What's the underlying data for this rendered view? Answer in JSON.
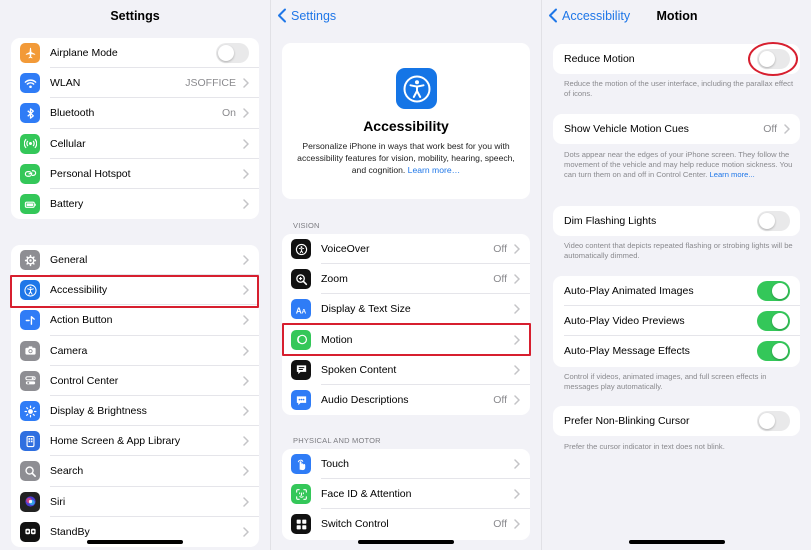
{
  "settings": {
    "title": "Settings",
    "group1": [
      {
        "label": "Airplane Mode",
        "icon": "airplane-icon",
        "color": "#f29a38",
        "toggle": false
      },
      {
        "label": "WLAN",
        "icon": "wifi-icon",
        "color": "#2f7cf6",
        "value": "JSOFFICE"
      },
      {
        "label": "Bluetooth",
        "icon": "bluetooth-icon",
        "color": "#2f7cf6",
        "value": "On"
      },
      {
        "label": "Cellular",
        "icon": "cellular-icon",
        "color": "#34c759"
      },
      {
        "label": "Personal Hotspot",
        "icon": "hotspot-icon",
        "color": "#34c759"
      },
      {
        "label": "Battery",
        "icon": "battery-icon",
        "color": "#34c759"
      }
    ],
    "group2": [
      {
        "label": "General",
        "icon": "gear-icon",
        "color": "#8e8e93"
      },
      {
        "label": "Accessibility",
        "icon": "accessibility-icon",
        "color": "#1f77e8"
      },
      {
        "label": "Action Button",
        "icon": "action-button-icon",
        "color": "#2f7cf6"
      },
      {
        "label": "Camera",
        "icon": "camera-icon",
        "color": "#8e8e93"
      },
      {
        "label": "Control Center",
        "icon": "control-center-icon",
        "color": "#8e8e93"
      },
      {
        "label": "Display & Brightness",
        "icon": "brightness-icon",
        "color": "#2f7cf6"
      },
      {
        "label": "Home Screen & App Library",
        "icon": "home-screen-icon",
        "color": "#2f6fe0"
      },
      {
        "label": "Search",
        "icon": "search-icon",
        "color": "#8e8e93"
      },
      {
        "label": "Siri",
        "icon": "siri-icon",
        "color": "#222222"
      },
      {
        "label": "StandBy",
        "icon": "standby-icon",
        "color": "#111111"
      }
    ]
  },
  "accessibility": {
    "back": "Settings",
    "hero_title": "Accessibility",
    "hero_desc": "Personalize iPhone in ways that work best for you with accessibility features for vision, mobility, hearing, speech, and cognition.",
    "hero_link": "Learn more…",
    "vision_header": "VISION",
    "vision": [
      {
        "label": "VoiceOver",
        "icon": "voiceover-icon",
        "color": "#111111",
        "value": "Off"
      },
      {
        "label": "Zoom",
        "icon": "zoom-icon",
        "color": "#111111",
        "value": "Off"
      },
      {
        "label": "Display & Text Size",
        "icon": "text-size-icon",
        "color": "#2f7cf6"
      },
      {
        "label": "Motion",
        "icon": "motion-icon",
        "color": "#34c759"
      },
      {
        "label": "Spoken Content",
        "icon": "spoken-content-icon",
        "color": "#111111"
      },
      {
        "label": "Audio Descriptions",
        "icon": "audio-descriptions-icon",
        "color": "#2f7cf6",
        "value": "Off"
      }
    ],
    "physical_header": "PHYSICAL AND MOTOR",
    "physical": [
      {
        "label": "Touch",
        "icon": "touch-icon",
        "color": "#2f7cf6"
      },
      {
        "label": "Face ID & Attention",
        "icon": "face-id-icon",
        "color": "#34c759"
      },
      {
        "label": "Switch Control",
        "icon": "switch-control-icon",
        "color": "#111111",
        "value": "Off"
      }
    ]
  },
  "motion": {
    "back": "Accessibility",
    "title": "Motion",
    "reduce_motion": {
      "label": "Reduce Motion",
      "on": false
    },
    "reduce_note": "Reduce the motion of the user interface, including the parallax effect of icons.",
    "vehicle": {
      "label": "Show Vehicle Motion Cues",
      "value": "Off"
    },
    "vehicle_note": "Dots appear near the edges of your iPhone screen. They follow the movement of the vehicle and may help reduce motion sickness. You can turn them on and off in Control Center.",
    "vehicle_link": "Learn more...",
    "dim": {
      "label": "Dim Flashing Lights",
      "on": false
    },
    "dim_note": "Video content that depicts repeated flashing or strobing lights will be automatically dimmed.",
    "autoplay": [
      {
        "label": "Auto-Play Animated Images",
        "on": true
      },
      {
        "label": "Auto-Play Video Previews",
        "on": true
      },
      {
        "label": "Auto-Play Message Effects",
        "on": true
      }
    ],
    "autoplay_note": "Control if videos, animated images, and full screen effects in messages play automatically.",
    "cursor": {
      "label": "Prefer Non-Blinking Cursor",
      "on": false
    },
    "cursor_note": "Prefer the cursor indicator in text does not blink."
  }
}
